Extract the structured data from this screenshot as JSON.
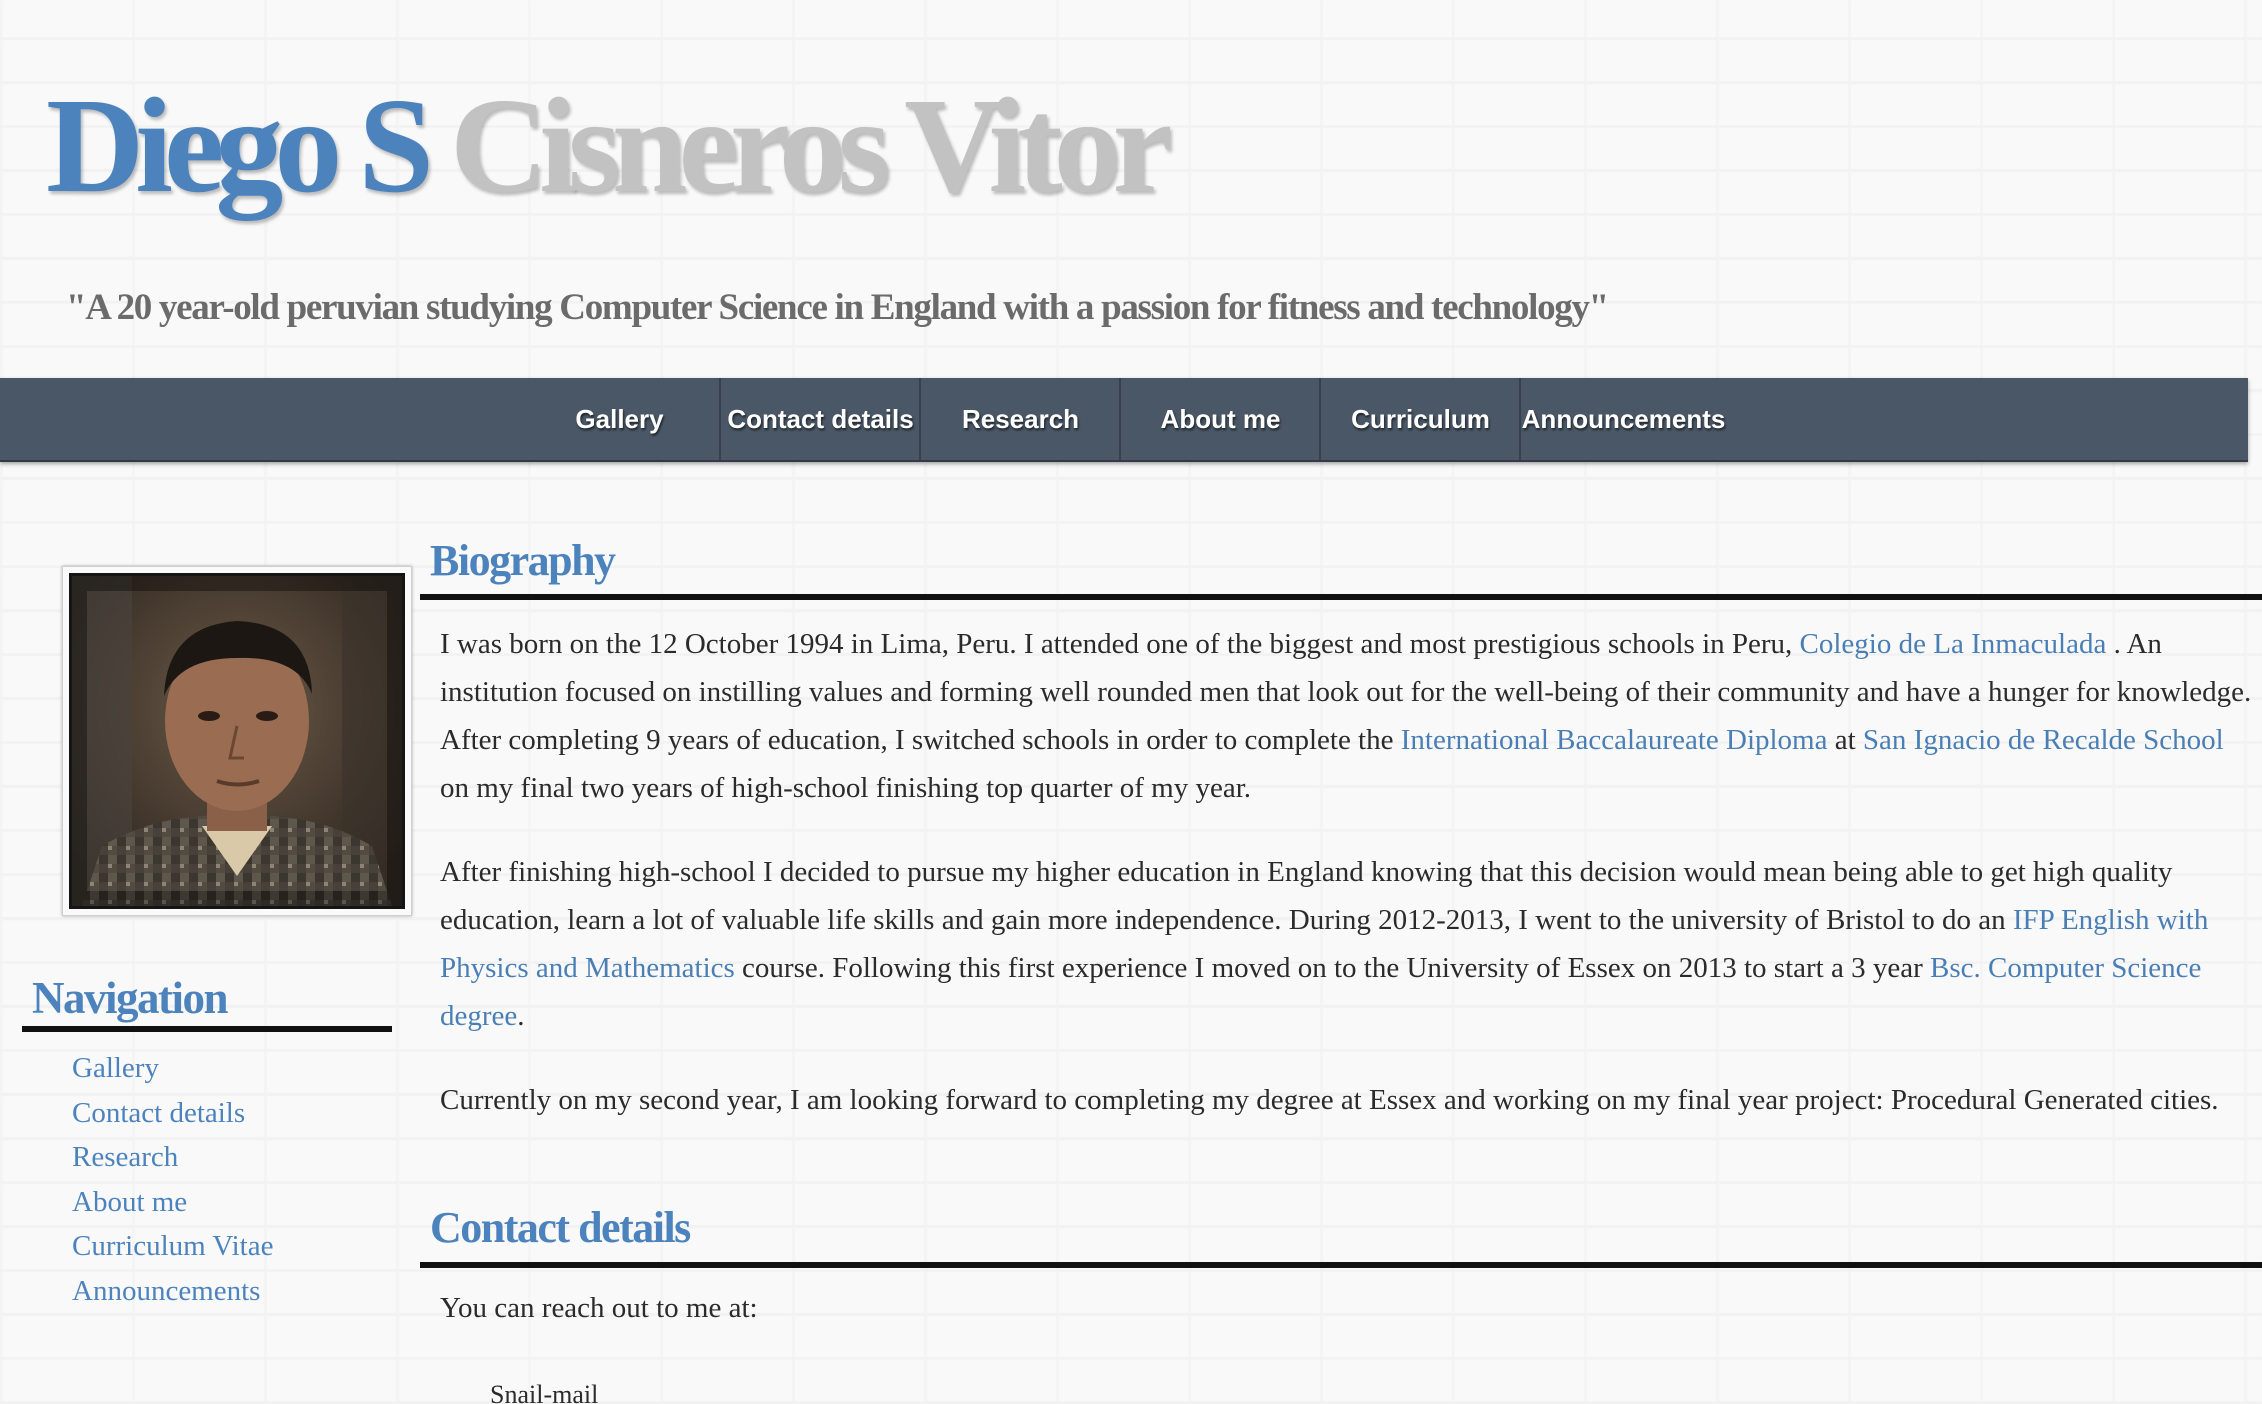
{
  "header": {
    "first_name": "Diego S",
    "last_name": "Cisneros Vitor",
    "tagline": "\"A 20 year-old peruvian studying Computer Science in England with a passion for fitness and technology\""
  },
  "topnav": {
    "items": [
      "Gallery",
      "Contact details",
      "Research",
      "About me",
      "Curriculum",
      "Announcements"
    ]
  },
  "sidebar": {
    "heading": "Navigation",
    "links": [
      "Gallery",
      "Contact details",
      "Research",
      "About me",
      "Curriculum Vitae",
      "Announcements"
    ]
  },
  "biography": {
    "heading": "Biography",
    "p1": {
      "t1": "I was born on the 12 October 1994 in Lima, Peru. I attended one of the biggest and most prestigious schools in Peru, ",
      "l1": "Colegio de La Inmaculada",
      "t2": " . An institution focused on instilling values and forming well rounded men that look out for the well-being of their community and have a hunger for knowledge. After completing 9 years of education, I switched schools in order to complete the ",
      "l2": "International Baccalaureate Diploma",
      "t3": " at ",
      "l3": "San Ignacio de Recalde School",
      "t4": " on my final two years of high-school finishing top quarter of my year."
    },
    "p2": {
      "t1": "After finishing high-school I decided to pursue my higher education in England knowing that this decision would mean being able to get high quality education, learn a lot of valuable life skills and gain more independence. During 2012-2013, I went to the university of Bristol to do an ",
      "l1": "IFP English with Physics and Mathematics",
      "t2": " course. Following this first experience I moved on to the University of Essex on 2013 to start a 3 year ",
      "l2": "Bsc. Computer Science degree",
      "t3": "."
    },
    "p3": "Currently on my second year, I am looking forward to completing my degree at Essex and working on my final year project: Procedural Generated cities."
  },
  "contact": {
    "heading": "Contact details",
    "intro": "You can reach out to me at:",
    "snail_mail": "Snail-mail"
  },
  "colors": {
    "accent": "#4d83bd",
    "nav_bar": "#4a5766",
    "title_grey": "#c2c2c2"
  }
}
